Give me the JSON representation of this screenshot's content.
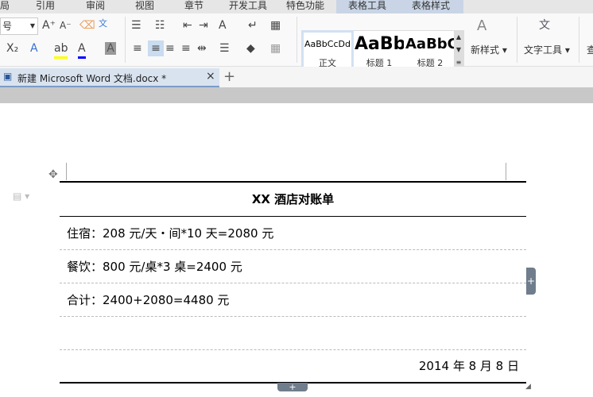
{
  "menu": {
    "tabs": [
      "局",
      "引用",
      "审阅",
      "视图",
      "章节",
      "开发工具",
      "特色功能",
      "表格工具",
      "表格样式"
    ]
  },
  "ribbon": {
    "font_size": "号",
    "styles": [
      {
        "preview": "AaBbCcDd",
        "label": "正文"
      },
      {
        "preview": "AaBb",
        "label": "标题 1"
      },
      {
        "preview": "AaBbC",
        "label": "标题 2"
      }
    ],
    "new_style": "新样式",
    "text_tools": "文字工具",
    "find": "查"
  },
  "document_tab": {
    "title": "新建 Microsoft Word 文档.docx *"
  },
  "table": {
    "title": "XX 酒店对账单",
    "rows": [
      "住宿：208 元/天・间*10 天=2080 元",
      "餐饮：800 元/桌*3 桌=2400 元",
      "合计：2400+2080=4480 元",
      ""
    ],
    "date": "2014 年 8 月 8 日"
  }
}
